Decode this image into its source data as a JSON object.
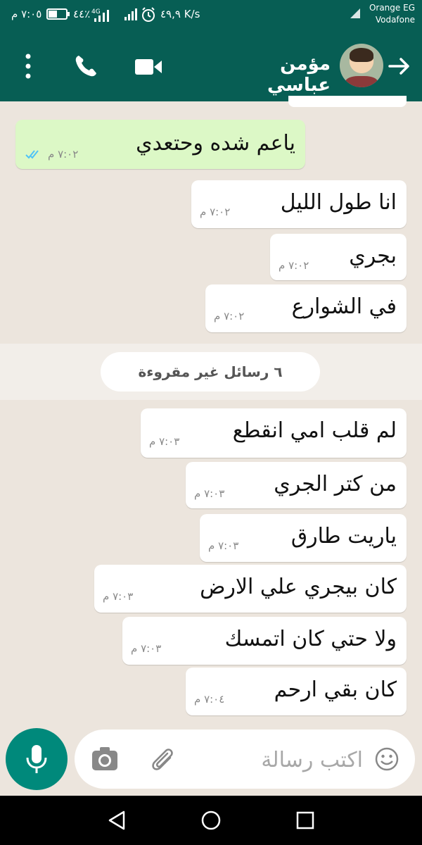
{
  "status_bar": {
    "carrier_1": "Orange EG",
    "carrier_2": "Vodafone",
    "network_speed": "٤٩,٩ K/s",
    "battery_percent": "٤٤٪",
    "time": "٧:٠٥ م"
  },
  "header": {
    "contact_name": "مؤمن عباسي"
  },
  "messages": [
    {
      "text": "ياعم شده وحتعدي",
      "time": "٧:٠٢ م",
      "outgoing": true
    },
    {
      "text": "انا طول الليل",
      "time": "٧:٠٢ م",
      "outgoing": false
    },
    {
      "text": "بجري",
      "time": "٧:٠٢ م",
      "outgoing": false
    },
    {
      "text": "في الشوارع",
      "time": "٧:٠٢ م",
      "outgoing": false
    },
    {
      "text": "لم قلب امي انقطع",
      "time": "٧:٠٣ م",
      "outgoing": false
    },
    {
      "text": "من كتر الجري",
      "time": "٧:٠٣ م",
      "outgoing": false
    },
    {
      "text": "ياريت طارق",
      "time": "٧:٠٣ م",
      "outgoing": false
    },
    {
      "text": "كان بيجري علي الارض",
      "time": "٧:٠٣ م",
      "outgoing": false
    },
    {
      "text": "ولا حتي كان اتمسك",
      "time": "٧:٠٣ م",
      "outgoing": false
    },
    {
      "text": "كان بقي ارحم",
      "time": "٧:٠٤ م",
      "outgoing": false
    }
  ],
  "unread_separator": "٦ رسائل غير مقروءة",
  "composer": {
    "placeholder": "اكتب رسالة"
  },
  "colors": {
    "header": "#075e54",
    "outgoing_bubble": "#dcf8c6",
    "incoming_bubble": "#ffffff",
    "mic_button": "#00897b",
    "read_ticks": "#4fc3f7"
  }
}
